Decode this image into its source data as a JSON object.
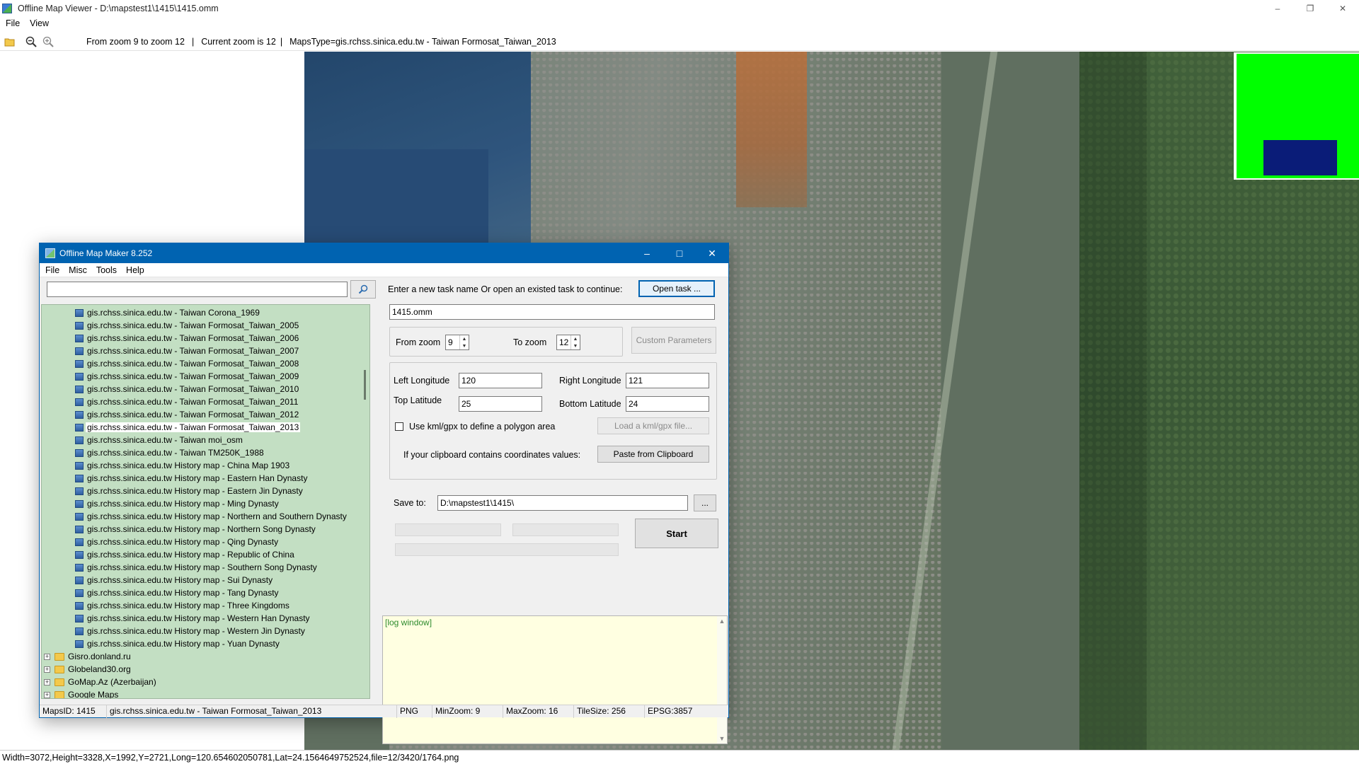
{
  "viewer": {
    "title": "Offline Map Viewer - D:\\mapstest1\\1415\\1415.omm",
    "menu": [
      "File",
      "View"
    ],
    "toolbar": {
      "zoom_range": "From zoom 9 to zoom 12",
      "current_zoom": "Current zoom is 12",
      "maps_type": "MapsType=gis.rchss.sinica.edu.tw - Taiwan Formosat_Taiwan_2013"
    },
    "status": "Width=3072,Height=3328,X=1992,Y=2721,Long=120.654602050781,Lat=24.1564649752524,file=12/3420/1764.png",
    "minimap_colors": {
      "background": "#00ff00",
      "viewport": "#0a1c78"
    }
  },
  "maker": {
    "title": "Offline Map Maker 8.252",
    "menu": [
      "File",
      "Misc",
      "Tools",
      "Help"
    ],
    "search": {
      "value": "",
      "placeholder": ""
    },
    "tree": [
      {
        "label": "gis.rchss.sinica.edu.tw - Taiwan Corona_1969",
        "type": "leaf"
      },
      {
        "label": "gis.rchss.sinica.edu.tw - Taiwan Formosat_Taiwan_2005",
        "type": "leaf"
      },
      {
        "label": "gis.rchss.sinica.edu.tw - Taiwan Formosat_Taiwan_2006",
        "type": "leaf"
      },
      {
        "label": "gis.rchss.sinica.edu.tw - Taiwan Formosat_Taiwan_2007",
        "type": "leaf"
      },
      {
        "label": "gis.rchss.sinica.edu.tw - Taiwan Formosat_Taiwan_2008",
        "type": "leaf"
      },
      {
        "label": "gis.rchss.sinica.edu.tw - Taiwan Formosat_Taiwan_2009",
        "type": "leaf"
      },
      {
        "label": "gis.rchss.sinica.edu.tw - Taiwan Formosat_Taiwan_2010",
        "type": "leaf"
      },
      {
        "label": "gis.rchss.sinica.edu.tw - Taiwan Formosat_Taiwan_2011",
        "type": "leaf"
      },
      {
        "label": "gis.rchss.sinica.edu.tw - Taiwan Formosat_Taiwan_2012",
        "type": "leaf"
      },
      {
        "label": "gis.rchss.sinica.edu.tw - Taiwan Formosat_Taiwan_2013",
        "type": "leaf",
        "selected": true
      },
      {
        "label": "gis.rchss.sinica.edu.tw - Taiwan moi_osm",
        "type": "leaf"
      },
      {
        "label": "gis.rchss.sinica.edu.tw - Taiwan TM250K_1988",
        "type": "leaf"
      },
      {
        "label": "gis.rchss.sinica.edu.tw History map - China Map 1903",
        "type": "leaf"
      },
      {
        "label": "gis.rchss.sinica.edu.tw History map - Eastern Han Dynasty",
        "type": "leaf"
      },
      {
        "label": "gis.rchss.sinica.edu.tw History map - Eastern Jin Dynasty",
        "type": "leaf"
      },
      {
        "label": "gis.rchss.sinica.edu.tw History map - Ming Dynasty",
        "type": "leaf"
      },
      {
        "label": "gis.rchss.sinica.edu.tw History map - Northern and Southern Dynasty",
        "type": "leaf"
      },
      {
        "label": "gis.rchss.sinica.edu.tw History map - Northern Song Dynasty",
        "type": "leaf"
      },
      {
        "label": "gis.rchss.sinica.edu.tw History map - Qing Dynasty",
        "type": "leaf"
      },
      {
        "label": "gis.rchss.sinica.edu.tw History map - Republic of China",
        "type": "leaf"
      },
      {
        "label": "gis.rchss.sinica.edu.tw History map - Southern Song Dynasty",
        "type": "leaf"
      },
      {
        "label": "gis.rchss.sinica.edu.tw History map - Sui Dynasty",
        "type": "leaf"
      },
      {
        "label": "gis.rchss.sinica.edu.tw History map - Tang Dynasty",
        "type": "leaf"
      },
      {
        "label": "gis.rchss.sinica.edu.tw History map - Three Kingdoms",
        "type": "leaf"
      },
      {
        "label": "gis.rchss.sinica.edu.tw History map - Western Han Dynasty",
        "type": "leaf"
      },
      {
        "label": "gis.rchss.sinica.edu.tw History map - Western Jin Dynasty",
        "type": "leaf"
      },
      {
        "label": "gis.rchss.sinica.edu.tw History map - Yuan Dynasty",
        "type": "leaf"
      },
      {
        "label": "Gisro.donland.ru",
        "type": "folder"
      },
      {
        "label": "Globeland30.org",
        "type": "folder"
      },
      {
        "label": "GoMap.Az (Azerbaijan)",
        "type": "folder"
      },
      {
        "label": "Google Maps",
        "type": "folder"
      }
    ],
    "task": {
      "prompt": "Enter a new task name Or open an existed task to continue:",
      "open_button": "Open task ...",
      "name_value": "1415.omm"
    },
    "zoom": {
      "from_label": "From zoom",
      "from_value": "9",
      "to_label": "To zoom",
      "to_value": "12",
      "custom_button": "Custom Parameters"
    },
    "bounds": {
      "left_label": "Left Longitude",
      "left_value": "120",
      "right_label": "Right Longitude",
      "right_value": "121",
      "top_label": "Top Latitude",
      "top_value": "25",
      "bottom_label": "Bottom Latitude",
      "bottom_value": "24",
      "kml_label": "Use kml/gpx to define a polygon area",
      "kml_button": "Load a kml/gpx file...",
      "clipboard_label": "If your clipboard contains coordinates values:",
      "clipboard_button": "Paste from Clipboard"
    },
    "save": {
      "label": "Save to:",
      "value": "D:\\mapstest1\\1415\\",
      "browse_button": "...",
      "start_button": "Start"
    },
    "log": {
      "text": "[log window]"
    },
    "status": {
      "maps_id": "MapsID: 1415",
      "maps_name": "gis.rchss.sinica.edu.tw - Taiwan Formosat_Taiwan_2013",
      "format": "PNG",
      "min_zoom": "MinZoom: 9",
      "max_zoom": "MaxZoom: 16",
      "tile_size": "TileSize: 256",
      "epsg": "EPSG:3857"
    }
  }
}
